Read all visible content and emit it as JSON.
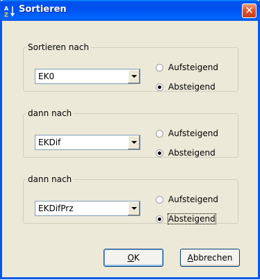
{
  "window": {
    "title": "Sortieren",
    "icon": "sort-az-icon",
    "close_symbol": "✕"
  },
  "groups": [
    {
      "legend": "Sortieren nach",
      "combo_value": "EK0",
      "ascending_label": "Aufsteigend",
      "descending_label": "Absteigend",
      "selected": "descending"
    },
    {
      "legend": "dann nach",
      "combo_value": "EKDif",
      "ascending_label": "Aufsteigend",
      "descending_label": "Absteigend",
      "selected": "descending"
    },
    {
      "legend": "dann nach",
      "combo_value": "EKDifPrz",
      "ascending_label": "Aufsteigend",
      "descending_label": "Absteigend",
      "selected": "descending"
    }
  ],
  "buttons": {
    "ok_mnemonic": "O",
    "ok_rest": "K",
    "cancel_mnemonic": "A",
    "cancel_rest": "bbrechen"
  },
  "colors": {
    "titlebar": "#0054e3",
    "dialog_bg": "#ece9d8",
    "close_button": "#e0542c"
  }
}
